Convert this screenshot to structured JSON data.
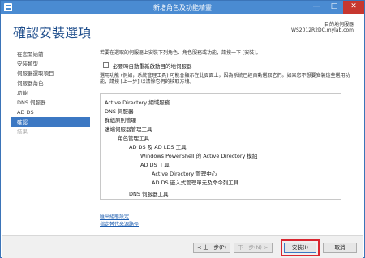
{
  "window": {
    "title": "新增角色及功能精靈",
    "minimize": "—",
    "maximize": "□",
    "close": "✕"
  },
  "header": {
    "page_title": "確認安裝選項",
    "dest_label": "目的地伺服器",
    "dest_server": "WS2012R2DC.mylab.com"
  },
  "sidebar": {
    "items": [
      {
        "label": "在您開始前"
      },
      {
        "label": "安裝類型"
      },
      {
        "label": "伺服器選取項目"
      },
      {
        "label": "伺服器角色"
      },
      {
        "label": "功能"
      },
      {
        "label": "DNS 伺服器"
      },
      {
        "label": "AD DS"
      },
      {
        "label": "確認"
      },
      {
        "label": "結果"
      }
    ]
  },
  "content": {
    "intro": "若要在選取的伺服器上安裝下列角色、角色服務或功能，請按一下 [安裝]。",
    "restart_label": "必要時自動重新啟動目的地伺服器",
    "note": "選用功能 (例如，系統管理工具) 可能會顯示在此頁面上，因為系統已經自動選取它們。如果您不想要安裝這些選用功能，請按 [上一步] 以清除它們的核取方塊。",
    "features": [
      "Active Directory 網域服務",
      "DNS 伺服器",
      "群組原則管理",
      "遠端伺服器管理工具",
      "角色管理工具",
      "AD DS 及 AD LDS 工具",
      "Windows PowerShell 的 Active Directory 模組",
      "AD DS 工具",
      "Active Directory 管理中心",
      "AD DS 嵌入式管理單元及命令列工具",
      "DNS 伺服器工具"
    ],
    "export_link": "匯出組態設定",
    "alt_source_link": "指定替代來源路徑"
  },
  "footer": {
    "previous": "< 上一步(P)",
    "next": "下一步(N) >",
    "install": "安裝(I)",
    "cancel": "取消"
  },
  "colors": {
    "accent": "#3c78c3",
    "titlebar": "#4a8bd2",
    "highlight": "#d9262f"
  }
}
